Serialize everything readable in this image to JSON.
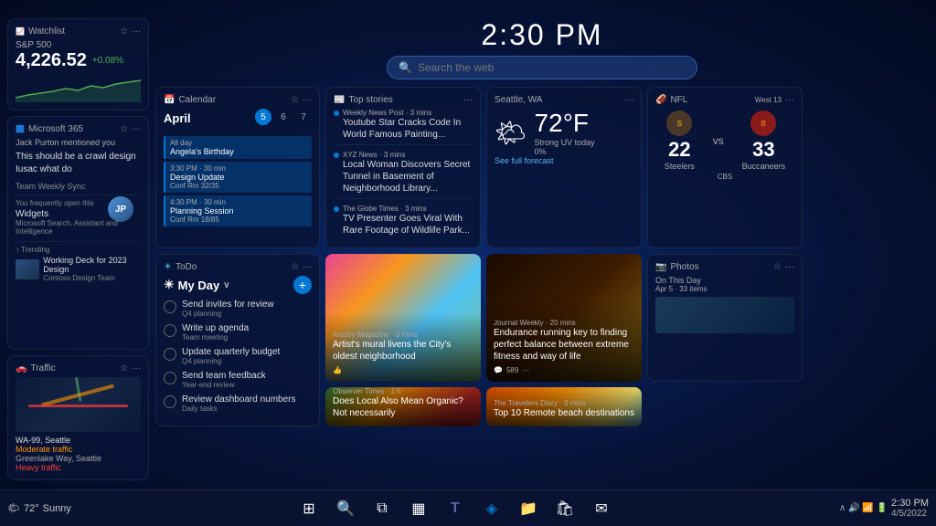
{
  "time": {
    "display": "2:30 PM",
    "taskbar_time": "2:30 PM",
    "taskbar_date": "4/5/2022"
  },
  "search": {
    "placeholder": "Search the web"
  },
  "taskbar": {
    "weather_temp": "72°",
    "weather_condition": "Sunny",
    "start_icon": "⊞",
    "search_icon": "🔍",
    "task_view_icon": "❑",
    "widgets_icon": "▦",
    "teams_icon": "T",
    "edge_icon": "◈",
    "explorer_icon": "📁",
    "store_icon": "🛍",
    "mail_icon": "✉",
    "system_tray": "∧  🔊  📶  🔋"
  },
  "widgets": {
    "stock": {
      "title": "Watchlist",
      "ticker": "S&P 500",
      "value": "4,226.52",
      "change": "+0.08%",
      "change_positive": true
    },
    "m365": {
      "title": "Microsoft 365",
      "mention_text": "Jack Purton mentioned you",
      "message": "This should be a crawl design Iusac what do",
      "meeting": "Team Weekly Sync",
      "frequently_label": "You frequently open this",
      "item1": "Widgets",
      "item1_sub": "Microsoft Search, Assistant and Intelligence",
      "trending_label": "↑ Trending",
      "trend_item": "Working Deck for 2023 Design",
      "trend_sub": "Contoso Design Team"
    },
    "calendar": {
      "title": "Calendar",
      "month": "April",
      "days": [
        "5",
        "6",
        "7"
      ],
      "today": "5",
      "all_day_label": "All day",
      "event1_title": "Angela's Birthday",
      "event2_time": "3:30 PM",
      "event2_duration": "30 min",
      "event2_title": "Design Update",
      "event2_conf": "Conf Rm 32/35",
      "event3_time": "4:30 PM",
      "event3_duration": "30 min",
      "event3_title": "Planning Session",
      "event3_conf": "Conf Rm 18/85"
    },
    "todo": {
      "title": "ToDo",
      "my_day": "My Day",
      "items": [
        {
          "text": "Send invites for review",
          "sub": "Q4 planning"
        },
        {
          "text": "Write up agenda",
          "sub": "Team meeting"
        },
        {
          "text": "Update quarterly budget",
          "sub": "Q4 planning"
        },
        {
          "text": "Send team feedback",
          "sub": "Year-end review"
        },
        {
          "text": "Review dashboard numbers",
          "sub": "Daily tasks"
        }
      ]
    },
    "top_stories": {
      "title": "Top stories",
      "items": [
        {
          "source": "Weekly News Post · 3 mins",
          "headline": "Youtube Star Cracks Code In World Famous Painting..."
        },
        {
          "source": "XYZ News · 3 mins",
          "headline": "Local Woman Discovers Secret Tunnel in Basement of Neighborhood Library..."
        },
        {
          "source": "The Globe Times · 3 mins",
          "headline": "TV Presenter Goes Viral With Rare Footage of Wildlife Park..."
        }
      ]
    },
    "weather": {
      "title": "Seattle, WA",
      "temp": "72°F",
      "desc": "Strong UV today",
      "uv": "0%",
      "forecast_link": "See full forecast",
      "icon": "🌤"
    },
    "nfl": {
      "title": "NFL",
      "info": "West 13",
      "team1": "Steelers",
      "team1_score": "22",
      "team1_color": "#4a3728",
      "team2": "Buccaneers",
      "team2_score": "33",
      "team2_color": "#8b1a1a",
      "cbs_label": "CBS"
    },
    "traffic": {
      "title": "Traffic",
      "road": "WA-99, Seattle",
      "status1": "Moderate traffic",
      "address": "Greenlake Way, Seattle",
      "status2": "Heavy traffic"
    },
    "photos": {
      "title": "Photos",
      "subtitle": "On This Day",
      "date": "Apr 5",
      "count": "33 items"
    },
    "news_cards": [
      {
        "source": "Artistry Magazine · 3 mins",
        "headline": "Artist's mural livens the City's oldest neighborhood",
        "likes": "",
        "img": "mural"
      },
      {
        "source": "Journal Weekly · 20 mins",
        "headline": "Endurance running key to finding perfect balance between extreme fitness and way of life",
        "comments": "589",
        "img": "running"
      },
      {
        "source": "Observer Times · 1 h",
        "headline": "Does Local Also Mean Organic? Not necessarily",
        "img": "produce"
      },
      {
        "source": "The Travelers Diary · 3 mins",
        "headline": "Top 10 Remote beach destinations",
        "img": "beach"
      }
    ]
  }
}
